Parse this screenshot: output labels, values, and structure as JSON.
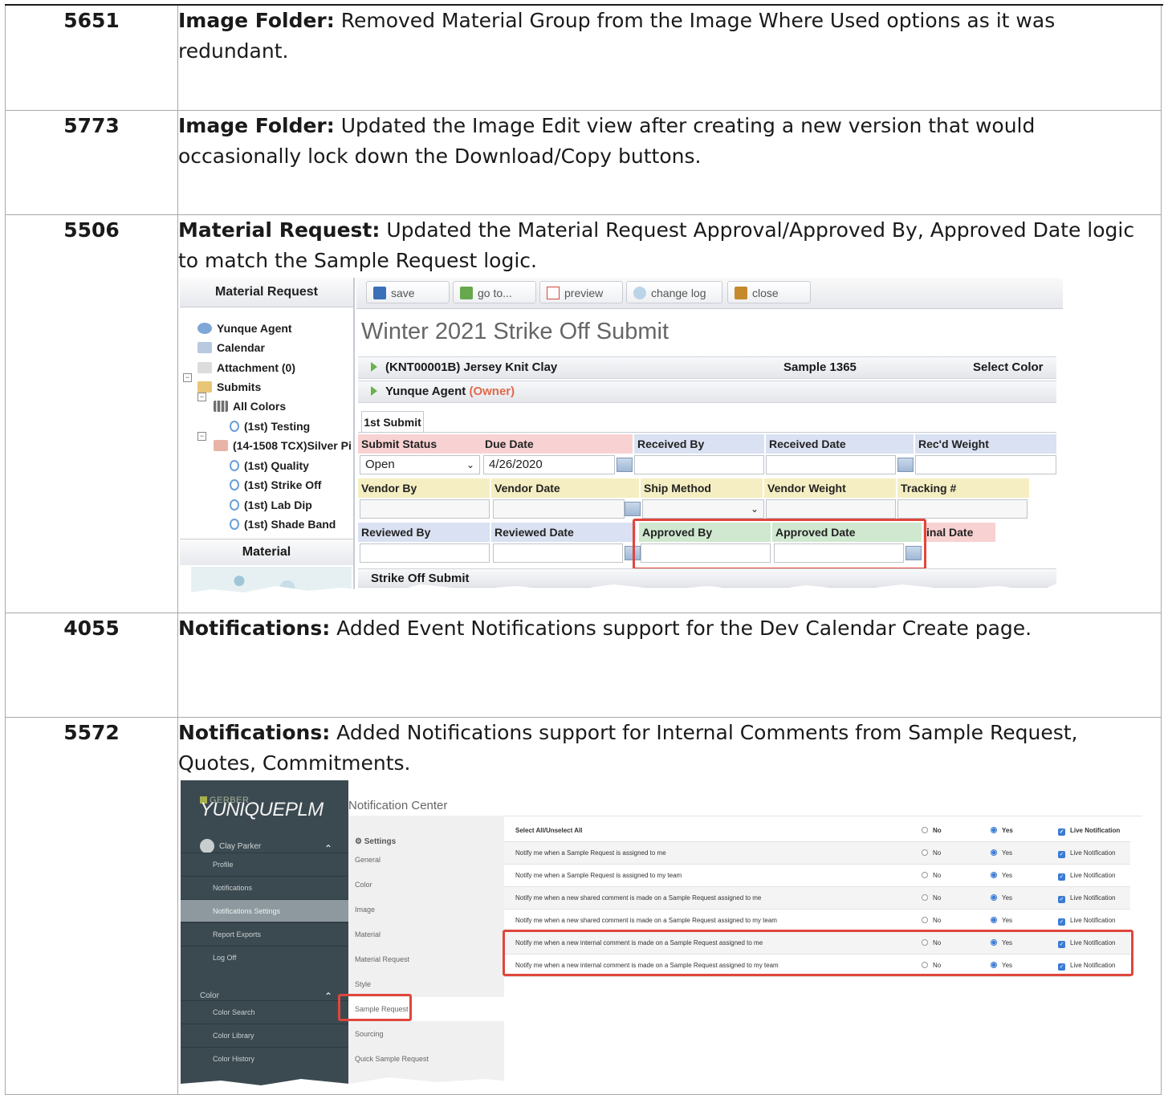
{
  "rows": [
    {
      "num": "5651",
      "area": "Image Folder:",
      "text": " Removed Material Group from the Image Where Used options as it was redundant."
    },
    {
      "num": "5773",
      "area": "Image Folder:",
      "text": " Updated the Image Edit view after creating a new version that would occasionally lock down the Download/Copy buttons."
    },
    {
      "num": "5506",
      "area": "Material Request:",
      "text": " Updated the Material Request Approval/Approved By, Approved Date logic to match the Sample Request logic."
    },
    {
      "num": "4055",
      "area": "Notifications:",
      "text": " Added Event Notifications support for the Dev Calendar Create page."
    },
    {
      "num": "5572",
      "area": "Notifications:",
      "text": " Added Notifications support for Internal Comments from Sample Request, Quotes, Commitments."
    }
  ],
  "screenshot1": {
    "sidebar_title": "Material Request",
    "tree": [
      "Yunque Agent",
      "Calendar",
      "Attachment (0)",
      "Submits",
      "All Colors",
      "(1st) Testing",
      "(14-1508 TCX)Silver Pi",
      "(1st) Quality",
      "(1st) Strike Off",
      "(1st) Lab Dip",
      "(1st) Shade Band"
    ],
    "material_title": "Material",
    "toolbar": {
      "save": "save",
      "goto": "go to...",
      "preview": "preview",
      "changelog": "change log",
      "close": "close"
    },
    "title": "Winter 2021 Strike Off Submit",
    "bar1": {
      "left": "(KNT00001B) Jersey Knit Clay",
      "mid": "Sample 1365",
      "right": "Select Color"
    },
    "bar2": {
      "name": "Yunque Agent",
      "role": "(Owner)"
    },
    "tab": "1st Submit",
    "labels_row1": [
      "Submit Status",
      "Due Date",
      "Received By",
      "Received Date",
      "Rec'd Weight"
    ],
    "status_value": "Open",
    "due_date_value": "4/26/2020",
    "labels_row2": [
      "Vendor By",
      "Vendor Date",
      "Ship Method",
      "Vendor Weight",
      "Tracking #"
    ],
    "labels_row3": [
      "Reviewed By",
      "Reviewed Date",
      "Approved By",
      "Approved Date",
      "inal Date"
    ],
    "bottom_section": "Strike Off Submit"
  },
  "screenshot2": {
    "brand_small": "GERBER",
    "brand": "YUNIQUEPLM",
    "user": "Clay Parker",
    "side_items": [
      "Profile",
      "Notifications",
      "Notifications Settings",
      "Report Exports",
      "Log Off"
    ],
    "color_section": "Color",
    "color_items": [
      "Color Search",
      "Color Library",
      "Color History"
    ],
    "header": "Notification Center",
    "settings": "Settings",
    "menu": [
      "General",
      "Color",
      "Image",
      "Material",
      "Material Request",
      "Style",
      "Sample Request",
      "Sourcing",
      "Quick Sample Request"
    ],
    "select_all": "Select All/Unselect All",
    "no": "No",
    "yes": "Yes",
    "live": "Live Notification",
    "questions": [
      "Notify me when a Sample Request is assigned to me",
      "Notify me when a Sample Request is assigned to my team",
      "Notify me when a new shared comment is made on a Sample Request assigned to me",
      "Notify me when a new shared comment is made on a Sample Request assigned to my team",
      "Notify me when a new internal comment is made on a Sample Request assigned to me",
      "Notify me when a new internal comment is made on a Sample Request assigned to my team"
    ]
  }
}
